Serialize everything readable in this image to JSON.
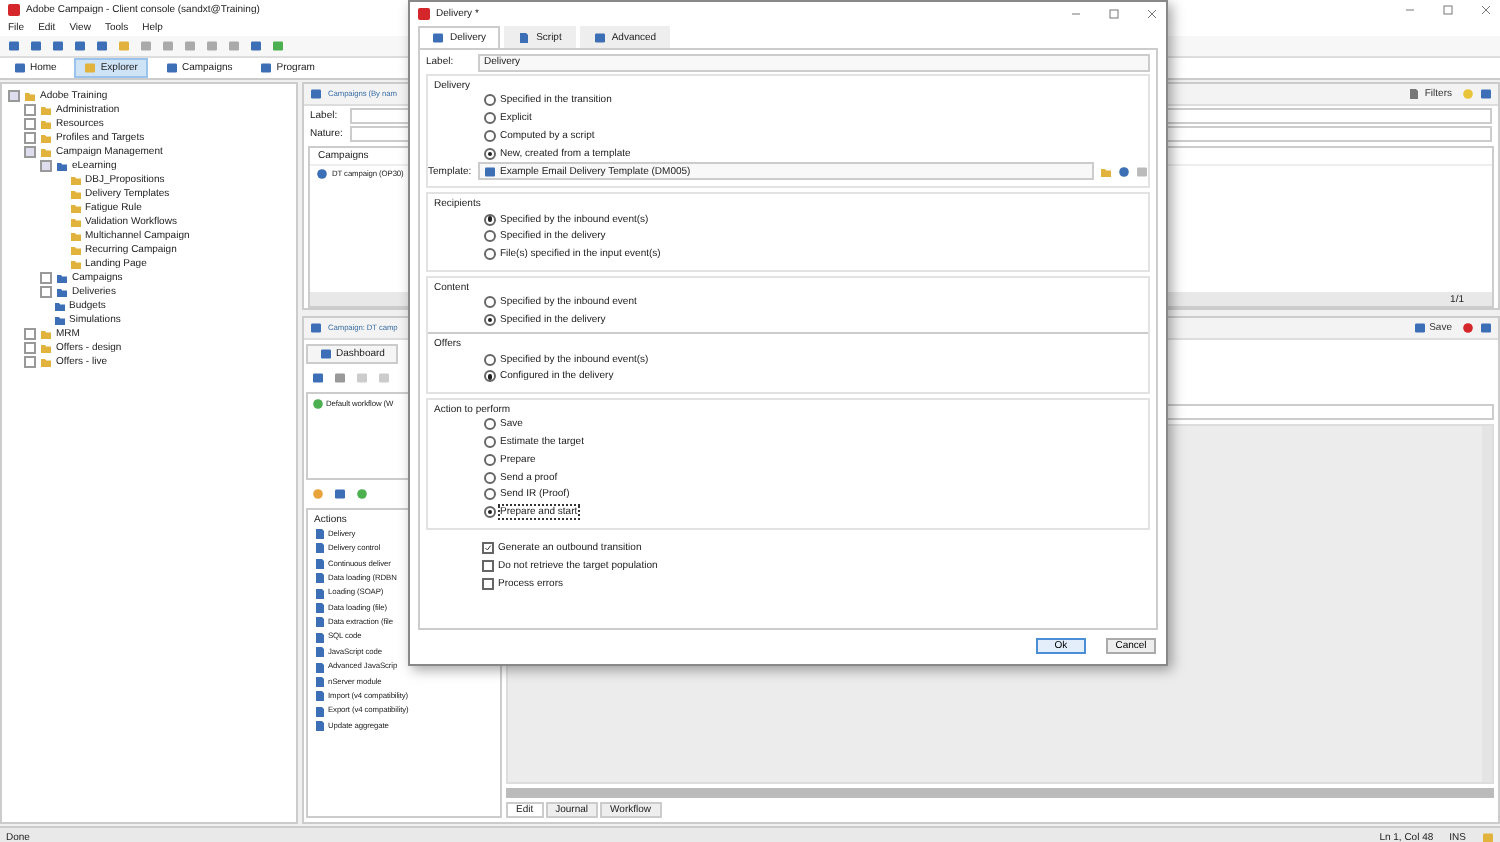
{
  "app_window": {
    "title": "Adobe Campaign - Client console (sandxt@Training)"
  },
  "menu": [
    "File",
    "Edit",
    "View",
    "Tools",
    "Help"
  ],
  "nav_tabs": [
    {
      "label": "Home",
      "selected": false
    },
    {
      "label": "Explorer",
      "selected": true
    },
    {
      "label": "Campaigns",
      "selected": false
    },
    {
      "label": "Program",
      "selected": false
    }
  ],
  "tree": [
    {
      "label": "Adobe Training",
      "expanded": true,
      "children": [
        {
          "label": "Administration",
          "expanded": false
        },
        {
          "label": "Resources",
          "expanded": false
        },
        {
          "label": "Profiles and Targets",
          "expanded": false
        },
        {
          "label": "Campaign Management",
          "expanded": true,
          "children": [
            {
              "label": "eLearning",
              "expanded": true,
              "children": [
                {
                  "label": "DBJ_Propositions"
                },
                {
                  "label": "Delivery Templates"
                },
                {
                  "label": "Fatigue Rule"
                },
                {
                  "label": "Validation Workflows"
                },
                {
                  "label": "Multichannel Campaign"
                },
                {
                  "label": "Recurring Campaign"
                },
                {
                  "label": "Landing Page"
                }
              ]
            },
            {
              "label": "Campaigns",
              "expanded": false
            },
            {
              "label": "Deliveries",
              "expanded": false
            },
            {
              "label": "Budgets"
            },
            {
              "label": "Simulations"
            }
          ]
        },
        {
          "label": "MRM",
          "expanded": false
        },
        {
          "label": "Offers - design",
          "expanded": false
        },
        {
          "label": "Offers - live",
          "expanded": false
        }
      ]
    }
  ],
  "campaign_list": {
    "title": "Campaigns (By nam",
    "filters": "Filters",
    "fields": [
      "Label:",
      "Nature:"
    ],
    "column": "Campaigns",
    "rows": [
      "DT campaign (OP30)"
    ],
    "pager": "1/1"
  },
  "campaign_editor": {
    "title": "Campaign: DT camp",
    "save": "Save",
    "tab": "Dashboard",
    "workflows": [
      "Default workflow (W"
    ],
    "actions_title": "Actions",
    "actions": [
      "Delivery",
      "Delivery control",
      "Continuous deliver",
      "Data loading (RDBN",
      "Loading (SOAP)",
      "Data loading (file)",
      "Data extraction (file",
      "SQL code",
      "JavaScript code",
      "Advanced JavaScrip",
      "nServer module",
      "Import (v4 compatibility)",
      "Export (v4 compatibility)",
      "Update aggregate"
    ],
    "bottom_tabs": [
      {
        "label": "Edit",
        "selected": true
      },
      {
        "label": "Journal",
        "selected": false
      },
      {
        "label": "Workflow",
        "selected": false
      }
    ]
  },
  "status_bar": {
    "message": "Done",
    "position": "Ln 1, Col 48",
    "mode": "INS"
  },
  "dialog": {
    "title": "Delivery *",
    "tabs": [
      {
        "label": "Delivery",
        "selected": true
      },
      {
        "label": "Script",
        "selected": false
      },
      {
        "label": "Advanced",
        "selected": false
      }
    ],
    "label_field": {
      "label": "Label:",
      "value": "Delivery"
    },
    "sections": [
      {
        "kind": "group",
        "title": "Delivery",
        "options": [
          {
            "label": "Specified in the transition",
            "selected": false
          },
          {
            "label": "Explicit",
            "selected": false
          },
          {
            "label": "Computed by a script",
            "selected": false
          },
          {
            "label": "New, created from a template",
            "selected": true
          }
        ],
        "template": {
          "label": "Template:",
          "value": "Example Email Delivery Template (DM005)"
        }
      },
      {
        "kind": "group",
        "title": "Recipients",
        "options": [
          {
            "label": "Specified by the inbound event(s)",
            "selected": true
          },
          {
            "label": "Specified in the delivery",
            "selected": false
          },
          {
            "label": "File(s) specified in the input event(s)",
            "selected": false
          }
        ]
      },
      {
        "kind": "group",
        "title": "Content",
        "options": [
          {
            "label": "Specified by the inbound event",
            "selected": false
          },
          {
            "label": "Specified in the delivery",
            "selected": true
          }
        ]
      },
      {
        "kind": "subgroup",
        "title": "Offers",
        "options": [
          {
            "label": "Specified by the inbound event(s)",
            "selected": false
          },
          {
            "label": "Configured in the delivery",
            "selected": true
          }
        ]
      },
      {
        "kind": "group",
        "title": "Action to perform",
        "options": [
          {
            "label": "Save",
            "selected": false
          },
          {
            "label": "Estimate the target",
            "selected": false
          },
          {
            "label": "Prepare",
            "selected": false
          },
          {
            "label": "Send a proof",
            "selected": false
          },
          {
            "label": "Send IR (Proof)",
            "selected": false
          },
          {
            "label": "Prepare and start",
            "selected": true
          }
        ]
      }
    ],
    "checkboxes": [
      {
        "label": "Generate an outbound transition",
        "checked": true
      },
      {
        "label": "Do not retrieve the target population",
        "checked": false
      },
      {
        "label": "Process errors",
        "checked": false
      }
    ],
    "buttons": [
      {
        "label": "Ok",
        "kind": "default"
      },
      {
        "label": "Cancel",
        "kind": "normal"
      }
    ]
  }
}
